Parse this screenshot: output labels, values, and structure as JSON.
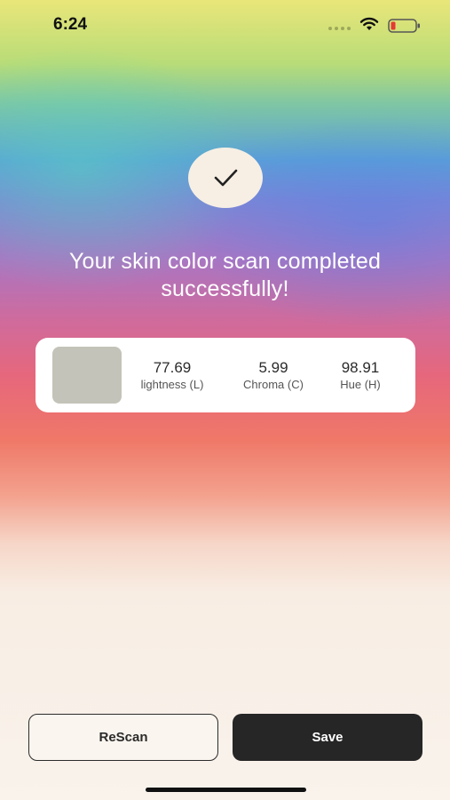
{
  "status_bar": {
    "time": "6:24",
    "battery_color": "#e53935"
  },
  "headline": "Your skin color scan completed successfully!",
  "result": {
    "swatch_color": "#c4c3b9",
    "metrics": [
      {
        "value": "77.69",
        "label": "lightness (L)"
      },
      {
        "value": "5.99",
        "label": "Chroma (C)"
      },
      {
        "value": "98.91",
        "label": "Hue (H)"
      }
    ]
  },
  "buttons": {
    "rescan_label": "ReScan",
    "save_label": "Save"
  },
  "icons": {
    "check": "check-icon",
    "wifi": "wifi-icon",
    "battery": "battery-icon"
  }
}
